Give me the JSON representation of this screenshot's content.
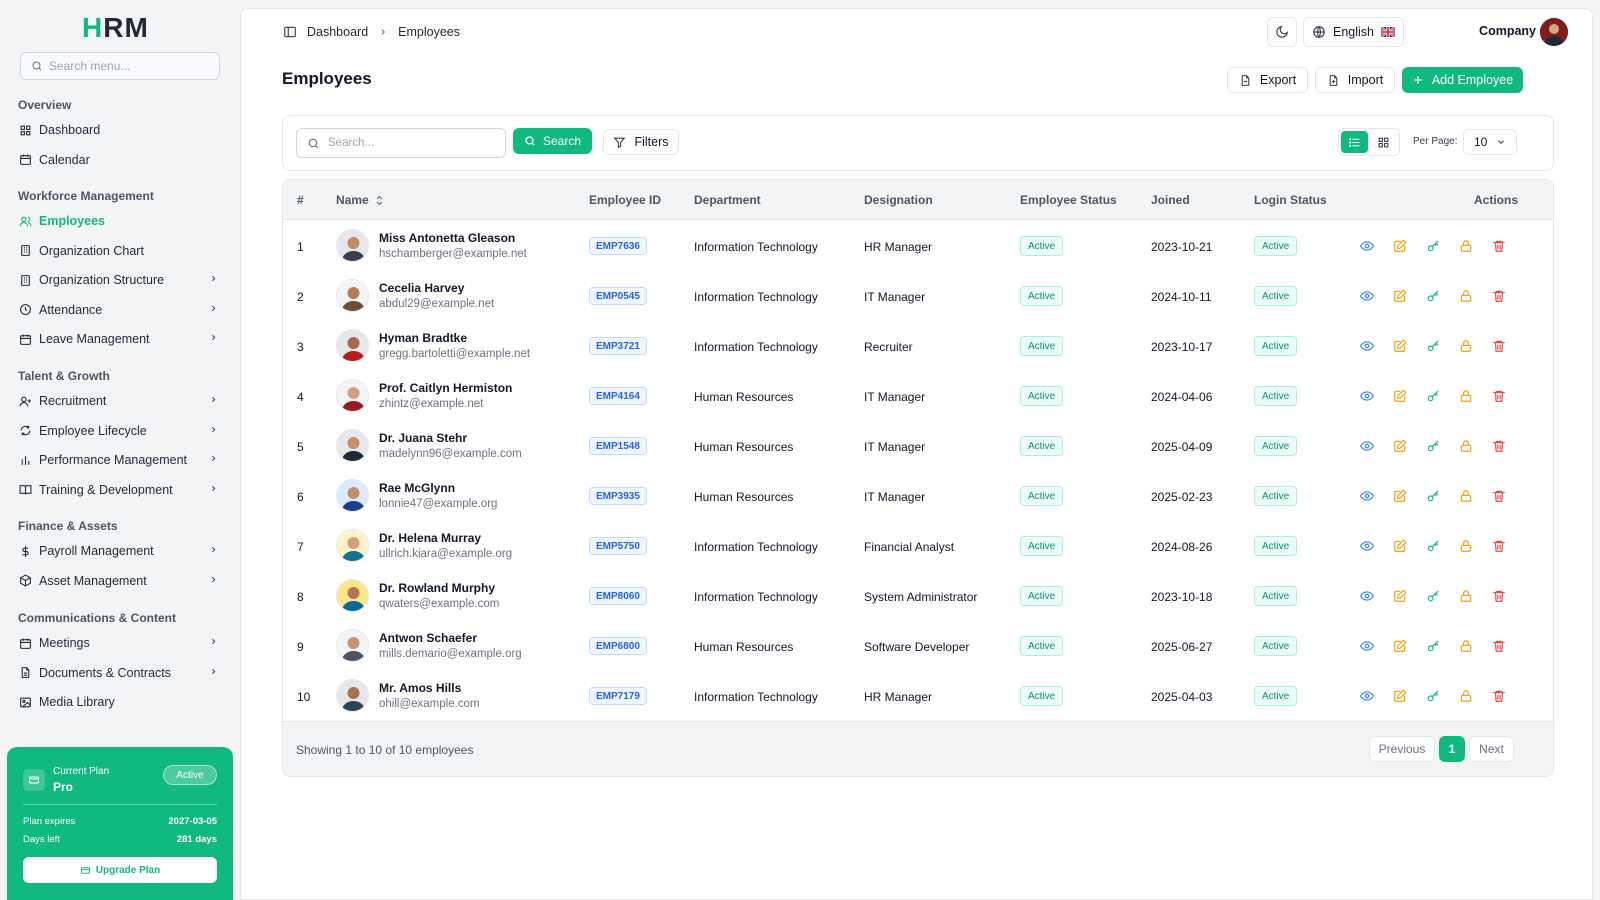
{
  "app": {
    "logo": "HRM"
  },
  "sidebar": {
    "search_placeholder": "Search menu...",
    "sections": [
      {
        "title": "Overview",
        "items": [
          {
            "label": "Dashboard",
            "icon": "grid-icon",
            "chevron": false,
            "active": false
          },
          {
            "label": "Calendar",
            "icon": "calendar-icon",
            "chevron": false,
            "active": false
          }
        ]
      },
      {
        "title": "Workforce Management",
        "items": [
          {
            "label": "Employees",
            "icon": "users-icon",
            "chevron": false,
            "active": true
          },
          {
            "label": "Organization Chart",
            "icon": "building-icon",
            "chevron": false,
            "active": false
          },
          {
            "label": "Organization Structure",
            "icon": "building-icon",
            "chevron": true,
            "active": false
          },
          {
            "label": "Attendance",
            "icon": "clock-icon",
            "chevron": true,
            "active": false
          },
          {
            "label": "Leave Management",
            "icon": "calendar-icon",
            "chevron": true,
            "active": false
          }
        ]
      },
      {
        "title": "Talent & Growth",
        "items": [
          {
            "label": "Recruitment",
            "icon": "user-plus-icon",
            "chevron": true,
            "active": false
          },
          {
            "label": "Employee Lifecycle",
            "icon": "refresh-icon",
            "chevron": true,
            "active": false
          },
          {
            "label": "Performance Management",
            "icon": "bar-chart-icon",
            "chevron": true,
            "active": false
          },
          {
            "label": "Training & Development",
            "icon": "book-icon",
            "chevron": true,
            "active": false
          }
        ]
      },
      {
        "title": "Finance & Assets",
        "items": [
          {
            "label": "Payroll Management",
            "icon": "dollar-icon",
            "chevron": true,
            "active": false
          },
          {
            "label": "Asset Management",
            "icon": "box-icon",
            "chevron": true,
            "active": false
          }
        ]
      },
      {
        "title": "Communications & Content",
        "items": [
          {
            "label": "Meetings",
            "icon": "calendar-icon",
            "chevron": true,
            "active": false
          },
          {
            "label": "Documents & Contracts",
            "icon": "document-icon",
            "chevron": true,
            "active": false
          },
          {
            "label": "Media Library",
            "icon": "image-icon",
            "chevron": false,
            "active": false
          }
        ]
      }
    ],
    "plan": {
      "label": "Current Plan",
      "name": "Pro",
      "status": "Active",
      "expires_label": "Plan expires",
      "expires_value": "2027-03-05",
      "days_label": "Days left",
      "days_value": "281 days",
      "upgrade_label": "Upgrade Plan"
    }
  },
  "topbar": {
    "breadcrumb": [
      "Dashboard",
      "Employees"
    ],
    "language": "English",
    "company": "Company"
  },
  "page": {
    "title": "Employees",
    "export_label": "Export",
    "import_label": "Import",
    "add_label": "Add Employee"
  },
  "toolbar": {
    "search_placeholder": "Search...",
    "search_label": "Search",
    "filters_label": "Filters",
    "per_page_label": "Per Page:",
    "per_page_value": "10"
  },
  "table": {
    "headers": {
      "index": "#",
      "name": "Name",
      "employee_id": "Employee ID",
      "department": "Department",
      "designation": "Designation",
      "status": "Employee Status",
      "joined": "Joined",
      "login": "Login Status",
      "actions": "Actions"
    },
    "rows": [
      {
        "num": "1",
        "name": "Miss Antonetta Gleason",
        "email": "hschamberger@example.net",
        "id": "EMP7636",
        "department": "Information Technology",
        "designation": "HR Manager",
        "status": "Active",
        "joined": "2023-10-21",
        "login": "Active"
      },
      {
        "num": "2",
        "name": "Cecelia Harvey",
        "email": "abdul29@example.net",
        "id": "EMP0545",
        "department": "Information Technology",
        "designation": "IT Manager",
        "status": "Active",
        "joined": "2024-10-11",
        "login": "Active"
      },
      {
        "num": "3",
        "name": "Hyman Bradtke",
        "email": "gregg.bartoletti@example.net",
        "id": "EMP3721",
        "department": "Information Technology",
        "designation": "Recruiter",
        "status": "Active",
        "joined": "2023-10-17",
        "login": "Active"
      },
      {
        "num": "4",
        "name": "Prof. Caitlyn Hermiston",
        "email": "zhintz@example.net",
        "id": "EMP4164",
        "department": "Human Resources",
        "designation": "IT Manager",
        "status": "Active",
        "joined": "2024-04-06",
        "login": "Active"
      },
      {
        "num": "5",
        "name": "Dr. Juana Stehr",
        "email": "madelynn96@example.com",
        "id": "EMP1548",
        "department": "Human Resources",
        "designation": "IT Manager",
        "status": "Active",
        "joined": "2025-04-09",
        "login": "Active"
      },
      {
        "num": "6",
        "name": "Rae McGlynn",
        "email": "lonnie47@example.org",
        "id": "EMP3935",
        "department": "Human Resources",
        "designation": "IT Manager",
        "status": "Active",
        "joined": "2025-02-23",
        "login": "Active"
      },
      {
        "num": "7",
        "name": "Dr. Helena Murray",
        "email": "ullrich.kiara@example.org",
        "id": "EMP5750",
        "department": "Information Technology",
        "designation": "Financial Analyst",
        "status": "Active",
        "joined": "2024-08-26",
        "login": "Active"
      },
      {
        "num": "8",
        "name": "Dr. Rowland Murphy",
        "email": "qwaters@example.com",
        "id": "EMP8060",
        "department": "Information Technology",
        "designation": "System Administrator",
        "status": "Active",
        "joined": "2023-10-18",
        "login": "Active"
      },
      {
        "num": "9",
        "name": "Antwon Schaefer",
        "email": "mills.demario@example.org",
        "id": "EMP6800",
        "department": "Human Resources",
        "designation": "Software Developer",
        "status": "Active",
        "joined": "2025-06-27",
        "login": "Active"
      },
      {
        "num": "10",
        "name": "Mr. Amos Hills",
        "email": "ohill@example.com",
        "id": "EMP7179",
        "department": "Information Technology",
        "designation": "HR Manager",
        "status": "Active",
        "joined": "2025-04-03",
        "login": "Active"
      }
    ],
    "footer": {
      "showing": "Showing 1 to 10 of 10 employees",
      "previous": "Previous",
      "current_page": "1",
      "next": "Next"
    }
  },
  "colors": {
    "accent": "#10b981",
    "view": "#3b82f6",
    "edit": "#f59e0b",
    "key": "#10b981",
    "lock": "#f59e0b",
    "delete": "#ef4444"
  }
}
